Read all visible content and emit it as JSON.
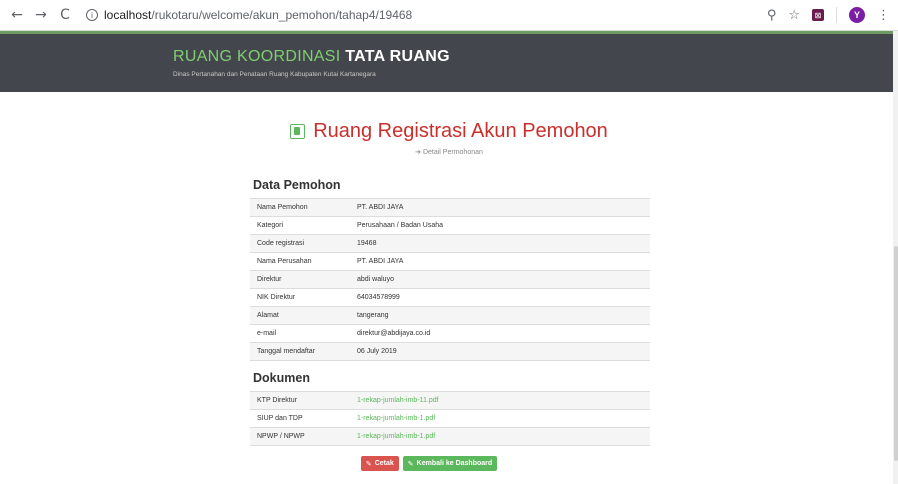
{
  "browser": {
    "back": "←",
    "forward": "→",
    "reload": "C",
    "info": "i",
    "url_host": "localhost",
    "url_path": "/rukotaru/welcome/akun_pemohon/tahap4/19468",
    "zoom": "⚲",
    "star": "☆",
    "extension": "⊠",
    "avatar": "Y",
    "menu": "⋮"
  },
  "header": {
    "title_part1": "RUANG KOORDINASI ",
    "title_part2": "TATA RUANG",
    "subtitle": "Dinas Pertanahan dan Penataan Ruang Kabupaten Kutai Kartanegara"
  },
  "page": {
    "title": "Ruang Registrasi Akun Pemohon",
    "detail_link": "Detail Permohonan"
  },
  "data_pemohon": {
    "heading": "Data Pemohon",
    "rows": [
      {
        "label": "Nama Pemohon",
        "value": "PT. ABDI JAYA"
      },
      {
        "label": "Kategori",
        "value": "Perusahaan / Badan Usaha"
      },
      {
        "label": "Code registrasi",
        "value": "19468"
      },
      {
        "label": "Nama Perusahan",
        "value": "PT. ABDI JAYA"
      },
      {
        "label": "Direktur",
        "value": "abdi waluyo"
      },
      {
        "label": "NIK Direktur",
        "value": "64034578999"
      },
      {
        "label": "Alamat",
        "value": "tangerang"
      },
      {
        "label": "e-mail",
        "value": "direktur@abdijaya.co.id"
      },
      {
        "label": "Tanggal mendaftar",
        "value": "06 July 2019"
      }
    ]
  },
  "dokumen": {
    "heading": "Dokumen",
    "rows": [
      {
        "label": "KTP Direktur",
        "value": "1-rekap-jumlah-imb-11.pdf"
      },
      {
        "label": "SIUP dan TDP",
        "value": "1-rekap-jumlah-imb-1.pdf"
      },
      {
        "label": "NPWP / NPWP",
        "value": "1-rekap-jumlah-imb-1.pdf"
      }
    ]
  },
  "buttons": {
    "cetak": "Cetak",
    "kembali": "Kembali ke Dashboard",
    "edit_glyph": "✎"
  },
  "colors": {
    "header_bg": "#43474d",
    "accent_green": "#5cb85c",
    "title_red": "#c9302c"
  }
}
